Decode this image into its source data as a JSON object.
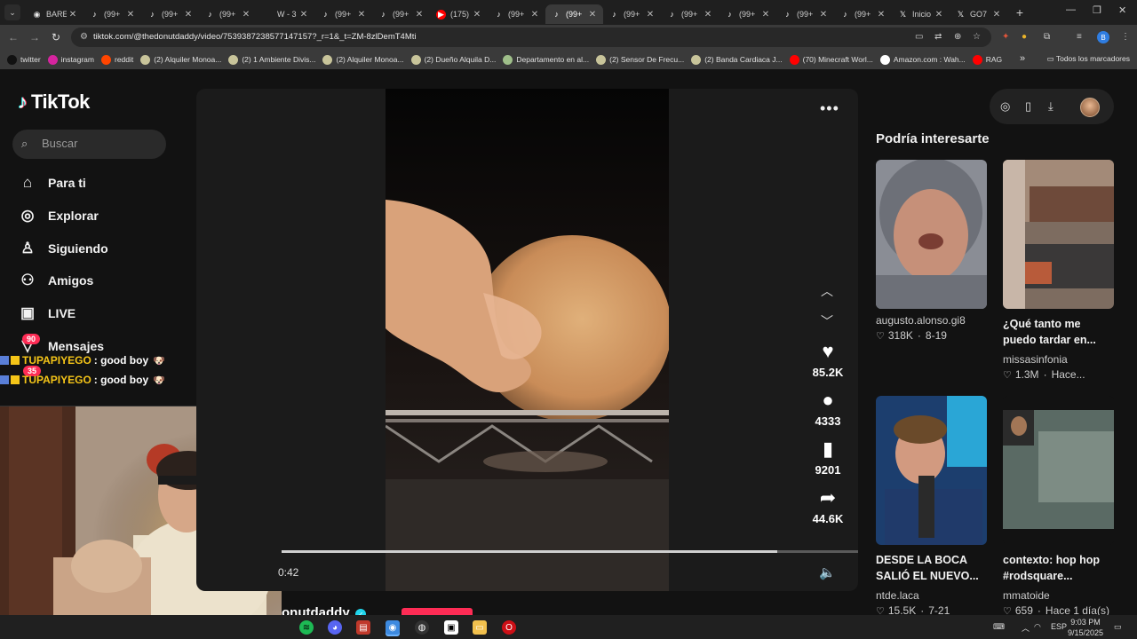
{
  "browser": {
    "tabs": [
      {
        "title": "BARE",
        "icon": "chrome-icon",
        "active": false
      },
      {
        "title": "(99+",
        "icon": "tiktok-icon",
        "active": false
      },
      {
        "title": "(99+",
        "icon": "tiktok-icon",
        "active": false
      },
      {
        "title": "(99+",
        "icon": "tiktok-icon",
        "active": false
      },
      {
        "title": "W - 3",
        "icon": "blank-icon",
        "active": false
      },
      {
        "title": "(99+",
        "icon": "tiktok-icon",
        "active": false
      },
      {
        "title": "(99+",
        "icon": "tiktok-icon",
        "active": false
      },
      {
        "title": "(175)",
        "icon": "youtube-icon",
        "active": false
      },
      {
        "title": "(99+",
        "icon": "tiktok-icon",
        "active": false
      },
      {
        "title": "(99+",
        "icon": "tiktok-icon",
        "active": true
      },
      {
        "title": "(99+",
        "icon": "tiktok-icon",
        "active": false
      },
      {
        "title": "(99+",
        "icon": "tiktok-icon",
        "active": false
      },
      {
        "title": "(99+",
        "icon": "tiktok-icon",
        "active": false
      },
      {
        "title": "(99+",
        "icon": "tiktok-icon",
        "active": false
      },
      {
        "title": "(99+",
        "icon": "tiktok-icon",
        "active": false
      },
      {
        "title": "Inicio",
        "icon": "x-icon",
        "active": false
      },
      {
        "title": "GO7",
        "icon": "x-icon",
        "active": false
      }
    ],
    "new_tab": "+",
    "url": "tiktok.com/@thedonutdaddy/video/7539387238577147157?_r=1&_t=ZM-8zlDemT4Mti",
    "bookmarks": [
      {
        "label": "twitter",
        "icon": "x-icon",
        "color": "#111111"
      },
      {
        "label": "instagram",
        "icon": "instagram-icon",
        "color": "#d6249f"
      },
      {
        "label": "reddit",
        "icon": "reddit-icon",
        "color": "#ff4500"
      },
      {
        "label": "(2) Alquiler Monoa...",
        "icon": "marketplace-icon",
        "color": "#c8c49a"
      },
      {
        "label": "(2) 1 Ambiente Divis...",
        "icon": "marketplace-icon",
        "color": "#c8c49a"
      },
      {
        "label": "(2) Alquiler Monoa...",
        "icon": "marketplace-icon",
        "color": "#c8c49a"
      },
      {
        "label": "(2) Dueño Alquila D...",
        "icon": "marketplace-icon",
        "color": "#c8c49a"
      },
      {
        "label": "Departamento en al...",
        "icon": "site-icon",
        "color": "#9fbf8a"
      },
      {
        "label": "(2) Sensor De Frecu...",
        "icon": "marketplace-icon",
        "color": "#c8c49a"
      },
      {
        "label": "(2) Banda Cardiaca J...",
        "icon": "marketplace-icon",
        "color": "#c8c49a"
      },
      {
        "label": "(70) Minecraft Worl...",
        "icon": "youtube-icon",
        "color": "#ff0000"
      },
      {
        "label": "Amazon.com : Wah...",
        "icon": "amazon-icon",
        "color": "#ffffff"
      },
      {
        "label": "RAG",
        "icon": "youtube-icon",
        "color": "#ff0000"
      }
    ],
    "bookmarks_more": "»",
    "all_bookmarks": "Todos los marcadores"
  },
  "sidebar": {
    "logo": "TikTok",
    "search_placeholder": "Buscar",
    "nav": [
      {
        "label": "Para ti",
        "icon": "home-icon"
      },
      {
        "label": "Explorar",
        "icon": "compass-icon"
      },
      {
        "label": "Siguiendo",
        "icon": "following-icon"
      },
      {
        "label": "Amigos",
        "icon": "friends-icon"
      },
      {
        "label": "LIVE",
        "icon": "live-icon"
      },
      {
        "label": "Mensajes",
        "icon": "messages-icon"
      }
    ],
    "messages_badge": "90",
    "second_badge": "35"
  },
  "chat": [
    {
      "user": "TUPAPIYEGO",
      "message": ": good boy"
    },
    {
      "user": "TUPAPIYEGO",
      "message": ": good boy"
    }
  ],
  "video": {
    "time": "0:42",
    "progress": 0.86,
    "author": "onutdaddy",
    "actions": [
      {
        "icon": "heart-icon",
        "count": "85.2K"
      },
      {
        "icon": "comment-icon",
        "count": "4333"
      },
      {
        "icon": "bookmark-icon",
        "count": "9201"
      },
      {
        "icon": "share-icon",
        "count": "44.6K"
      }
    ]
  },
  "suggestions": {
    "title": "Podría interesarte",
    "cards": [
      {
        "title": "",
        "author": "augusto.alonso.gi8",
        "likes": "318K",
        "date": "8-19"
      },
      {
        "title": "¿Qué tanto me puedo tardar en...",
        "author": "missasinfonia",
        "likes": "1.3M",
        "date": "Hace..."
      },
      {
        "title": "DESDE LA BOCA SALIÓ EL NUEVO...",
        "author": "ntde.laca",
        "likes": "15.5K",
        "date": "7-21"
      },
      {
        "title": "contexto: hop hop #rodsquare...",
        "author": "mmatoide",
        "likes": "659",
        "date": "Hace 1 día(s)"
      }
    ]
  },
  "taskbar": {
    "lang": "ESP",
    "time": "9:03 PM",
    "date": "9/15/2025"
  }
}
